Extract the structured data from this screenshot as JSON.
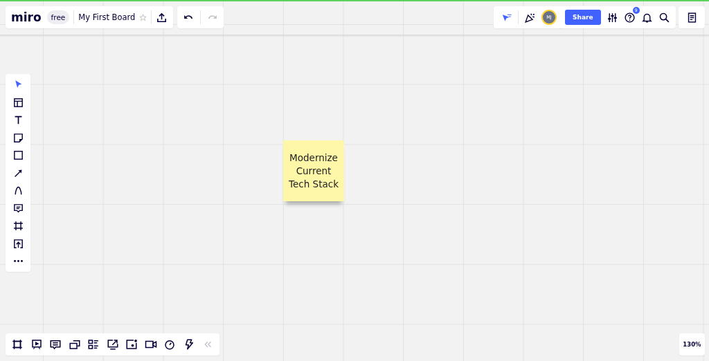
{
  "app": {
    "logo": "miro",
    "plan": "free",
    "board_title": "My First Board",
    "starred": false
  },
  "history": {
    "undo_disabled": false,
    "redo_disabled": true
  },
  "collaboration": {
    "avatar_initials": "MJ"
  },
  "share_button": "Share",
  "help_badge": "9",
  "tools": [
    {
      "kind": "select",
      "selected": true
    },
    {
      "kind": "templates",
      "selected": false
    },
    {
      "kind": "text",
      "selected": false
    },
    {
      "kind": "sticky",
      "selected": false
    },
    {
      "kind": "shape",
      "selected": false
    },
    {
      "kind": "arrow",
      "selected": false
    },
    {
      "kind": "pen",
      "selected": false
    },
    {
      "kind": "comment",
      "selected": false
    },
    {
      "kind": "frame",
      "selected": false
    },
    {
      "kind": "upload",
      "selected": false
    },
    {
      "kind": "more",
      "selected": false
    }
  ],
  "bottom_tools": [
    {
      "kind": "frames"
    },
    {
      "kind": "present"
    },
    {
      "kind": "chat"
    },
    {
      "kind": "cards"
    },
    {
      "kind": "list"
    },
    {
      "kind": "screen"
    },
    {
      "kind": "embed"
    },
    {
      "kind": "video"
    },
    {
      "kind": "timer"
    },
    {
      "kind": "bolt"
    }
  ],
  "sticky_note": {
    "text": "Modernize Current Tech Stack"
  },
  "zoom": "130%"
}
